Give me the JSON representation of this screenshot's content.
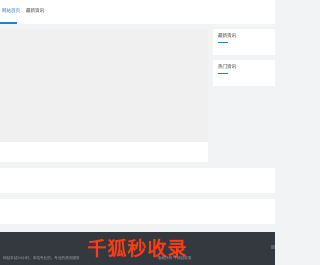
{
  "nav": {
    "items": [
      {
        "label": "网站首页"
      },
      {
        "label": "最新资讯"
      }
    ]
  },
  "sidebar": {
    "latest_title": "最新资讯",
    "hot_title": "热门资讯"
  },
  "footer": {
    "watermark": "千狐秒收录",
    "line1": "网站本站24小时，本站专业的、专业的资讯服务",
    "line2": "版权所有 千网站收录"
  },
  "colors": {
    "accent": "#2a7ec2",
    "footer_bg": "#34393f",
    "watermark": "#ff3b13"
  }
}
